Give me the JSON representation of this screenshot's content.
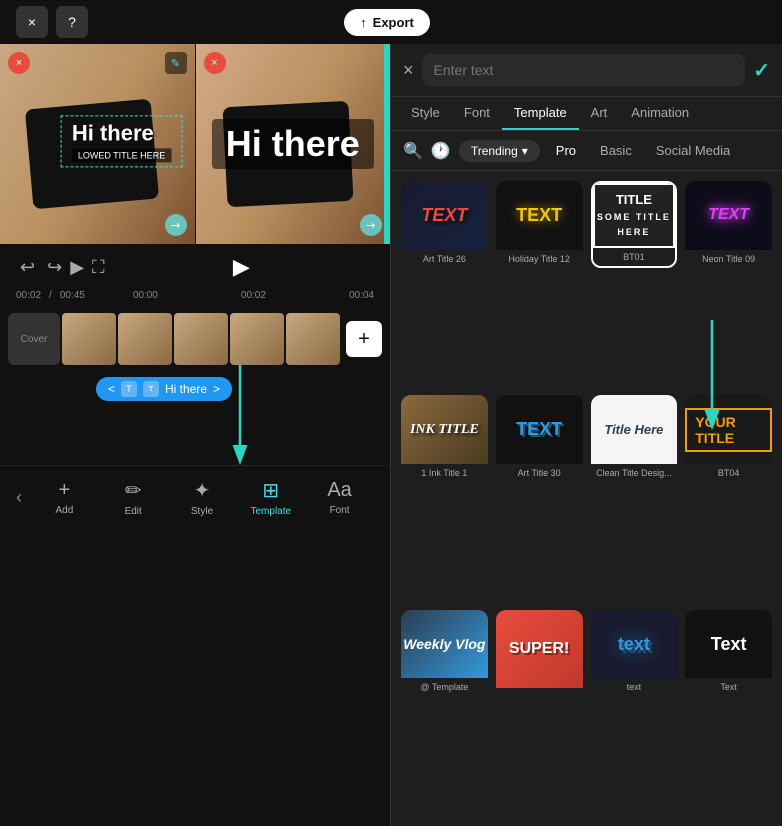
{
  "topBar": {
    "closeLabel": "×",
    "helpLabel": "?",
    "exportLabel": "Export",
    "exportIcon": "↑"
  },
  "leftPreview": {
    "hiThereText": "Hi there",
    "lowerTitle": "LOWED TITLE HERE",
    "closeIcon": "×",
    "editIcon": "✎",
    "resizeIcon": "↗"
  },
  "rightPreview": {
    "hiThereText": "Hi there",
    "closeIcon": "×",
    "resizeIcon": "↗"
  },
  "timeline": {
    "undoIcon": "↩",
    "redoIcon": "↪",
    "playIcon": "▶",
    "fullscreenIcon": "⛶",
    "playIcon2": "▶",
    "timeStart": "00:02",
    "timeDuration": "00:45",
    "timeZero": "00:00",
    "timeTwo": "00:02",
    "timeFour": "00:04",
    "coverLabel": "Cover",
    "addIcon": "+",
    "textTrackLabel": "Hi there",
    "trackExpandLeft": "<",
    "trackExpandRight": ">"
  },
  "bottomToolbar": {
    "chevronIcon": "‹",
    "addLabel": "Add",
    "editLabel": "Edit",
    "styleLabel": "Style",
    "templateLabel": "Template",
    "fontLabel": "Font",
    "addIcon": "+",
    "editIcon": "✏",
    "styleIcon": "✦",
    "templateIcon": "⊞",
    "fontIcon": "Aa"
  },
  "rightPanel": {
    "closeIcon": "×",
    "textPlaceholder": "Enter text",
    "confirmIcon": "✓",
    "tabs": [
      "Style",
      "Font",
      "Template",
      "Art",
      "Animation"
    ],
    "activeTab": "Template",
    "searchIcon": "🔍",
    "historyIcon": "🕐",
    "trendingLabel": "Trending",
    "filterTabs": [
      "Pro",
      "Basic",
      "Social Media"
    ],
    "templates": [
      {
        "id": "art-title-26",
        "label": "Art Title 26",
        "style": "art26"
      },
      {
        "id": "holiday-title-12",
        "label": "Holiday Title 12",
        "style": "holiday"
      },
      {
        "id": "bt01",
        "label": "BT01",
        "style": "bt01",
        "selected": true
      },
      {
        "id": "neon-title-09",
        "label": "Neon Title 09",
        "style": "neon"
      },
      {
        "id": "ink-title-1",
        "label": "1 Ink Title 1",
        "style": "ink"
      },
      {
        "id": "art-title-30",
        "label": "Art Title 30",
        "style": "art30"
      },
      {
        "id": "clean-title-design",
        "label": "Clean Title Desig...",
        "style": "clean"
      },
      {
        "id": "bt04",
        "label": "BT04",
        "style": "bt04"
      },
      {
        "id": "weekly-vlog",
        "label": "",
        "style": "weekly"
      },
      {
        "id": "super",
        "label": "",
        "style": "super"
      },
      {
        "id": "text-3d",
        "label": "",
        "style": "text3d"
      },
      {
        "id": "text-plain",
        "label": "",
        "style": "textplain"
      }
    ]
  }
}
